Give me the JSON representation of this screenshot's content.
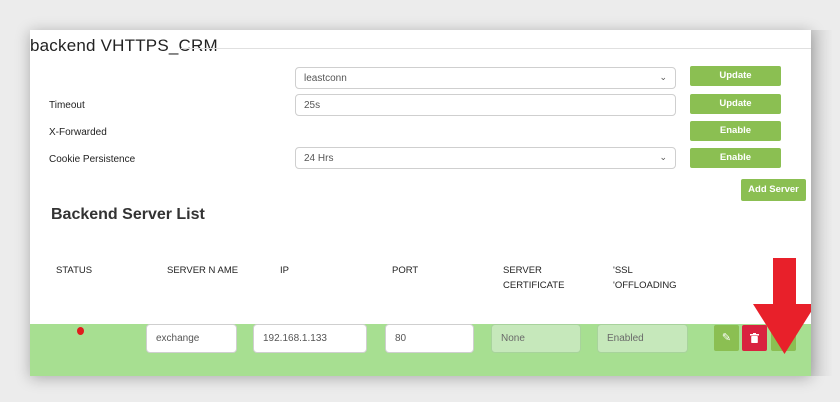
{
  "title": "backend VHTTPS_CRM",
  "settings": {
    "balance_value": "leastconn",
    "timeout_label": "Timeout",
    "timeout_value": "25s",
    "xforwarded_label": "X-Forwarded",
    "cookie_label": "Cookie Persistence",
    "cookie_value": "24 Hrs"
  },
  "buttons": {
    "update1": "Update",
    "update2": "Update",
    "enable1": "Enable",
    "enable2": "Enable",
    "add_server": "Add Server"
  },
  "server_list": {
    "heading": "Backend Server List",
    "columns": {
      "status": "STATUS",
      "server_name": "SERVER N AME",
      "ip": "IP",
      "port": "PORT",
      "cert_line1": "SERVER",
      "cert_line2": "CERTIFICATE",
      "ssl_line1": "'SSL",
      "ssl_line2": "'OFFLOADING"
    },
    "row": {
      "name": "exchange",
      "ip": "192.168.1.133",
      "port": "80",
      "certificate": "None",
      "ssl": "Enabled"
    }
  },
  "colors": {
    "accent": "#8bbf52",
    "row_bg": "#a7df91",
    "delete": "#d9223f",
    "arrow": "#e8202a"
  },
  "icons": [
    "chevron-down-icon",
    "edit-icon",
    "trash-icon",
    "wrench-icon",
    "arrow-down-icon"
  ]
}
